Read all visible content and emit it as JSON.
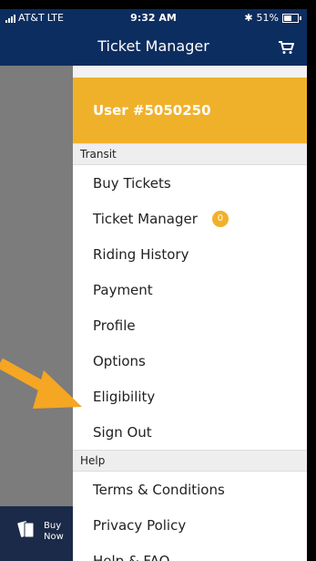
{
  "status_bar": {
    "carrier": "AT&T",
    "network": "LTE",
    "time": "9:32 AM",
    "battery": "51%"
  },
  "header": {
    "title": "Ticket Manager",
    "icons": {
      "cart": "cart-icon"
    }
  },
  "drawer": {
    "user_label": "User #5050250",
    "transit_header": "Transit",
    "transit_items": [
      {
        "label": "Buy Tickets"
      },
      {
        "label": "Ticket Manager",
        "badge": "0"
      },
      {
        "label": "Riding History"
      },
      {
        "label": "Payment"
      },
      {
        "label": "Profile"
      },
      {
        "label": "Options"
      },
      {
        "label": "Eligibility"
      },
      {
        "label": "Sign Out"
      }
    ],
    "help_header": "Help",
    "help_items": [
      {
        "label": "Terms & Conditions"
      },
      {
        "label": "Privacy Policy"
      },
      {
        "label": "Help & FAQ"
      }
    ]
  },
  "buy_now": {
    "label": "Buy\nNow"
  },
  "colors": {
    "nav_blue": "#0c2d5f",
    "accent_orange": "#f0b12a",
    "overlay_gray": "#7c7c7c"
  }
}
